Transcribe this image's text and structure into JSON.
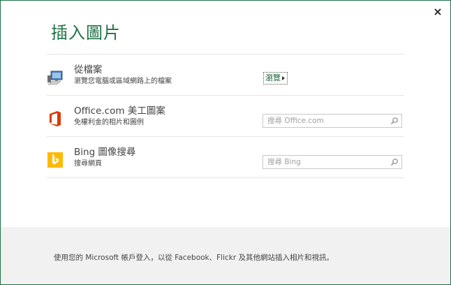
{
  "dialog": {
    "title": "插入圖片",
    "close_label": "✕"
  },
  "sources": [
    {
      "title": "從檔案",
      "subtitle": "瀏覽您電腦或區域網路上的檔案",
      "action": "瀏覽",
      "icon": "computer-icon"
    },
    {
      "title": "Office.com 美工圖案",
      "subtitle": "免權利金的相片和圖例",
      "placeholder": "搜尋 Office.com",
      "icon": "office-logo-icon"
    },
    {
      "title": "Bing 圖像搜尋",
      "subtitle": "搜尋網頁",
      "placeholder": "搜尋 Bing",
      "icon": "bing-logo-icon"
    }
  ],
  "footer": {
    "text": "使用您的 Microsoft 帳戶登入，以從 Facebook、Flickr 及其他網站插入相片和視訊。"
  },
  "colors": {
    "accent": "#217346",
    "office_orange": "#d83b01",
    "bing_yellow": "#ffb900"
  }
}
